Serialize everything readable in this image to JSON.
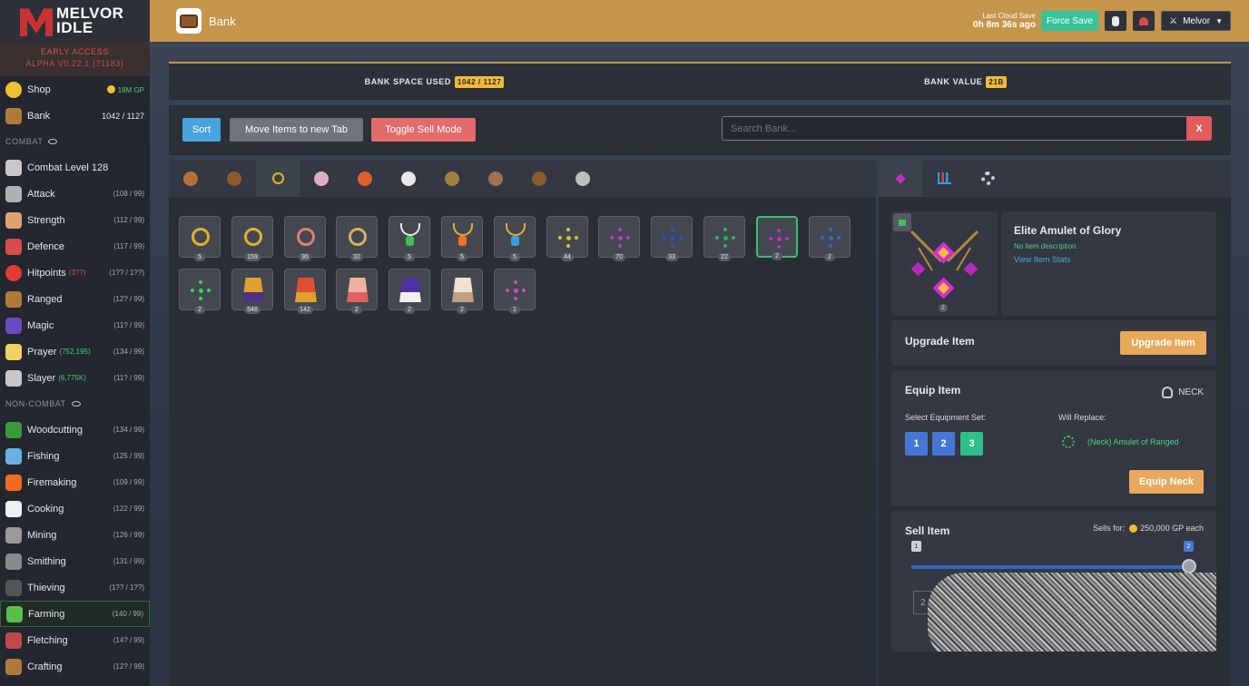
{
  "app": {
    "logo_top": "MELVOR",
    "logo_bottom": "IDLE",
    "early_access": "EARLY ACCESS",
    "version": "ALPHA V0.22.1 (?1183)"
  },
  "sidebar": {
    "top_items": [
      {
        "label": "Shop",
        "value": "18M GP",
        "icon": "coin-icon"
      },
      {
        "label": "Bank",
        "value": "1042 / 1127",
        "icon": "chest-icon"
      }
    ],
    "combat_header": "COMBAT",
    "combat": [
      {
        "label": "Combat Level 128",
        "value": "",
        "extra": "",
        "icon": "crossed-swords-icon"
      },
      {
        "label": "Attack",
        "value": "(108 / 99)",
        "extra": "",
        "icon": "sword-icon"
      },
      {
        "label": "Strength",
        "value": "(112 / 99)",
        "extra": "",
        "icon": "fist-icon"
      },
      {
        "label": "Defence",
        "value": "(117 / 99)",
        "extra": "",
        "icon": "shield-icon"
      },
      {
        "label": "Hitpoints",
        "value": "(1?? / 1??)",
        "extra": "(3??)",
        "icon": "heart-icon"
      },
      {
        "label": "Ranged",
        "value": "(12? / 99)",
        "extra": "",
        "icon": "bow-icon"
      },
      {
        "label": "Magic",
        "value": "(11? / 99)",
        "extra": "",
        "icon": "wizard-hat-icon"
      },
      {
        "label": "Prayer",
        "value": "(134 / 99)",
        "extra": "(752,195)",
        "icon": "sparkle-icon"
      },
      {
        "label": "Slayer",
        "value": "(11? / 99)",
        "extra": "(6,775K)",
        "icon": "skull-icon"
      }
    ],
    "noncombat_header": "NON-COMBAT",
    "noncombat": [
      {
        "label": "Woodcutting",
        "value": "(134 / 99)",
        "icon": "tree-icon"
      },
      {
        "label": "Fishing",
        "value": "(125 / 99)",
        "icon": "fish-icon"
      },
      {
        "label": "Firemaking",
        "value": "(109 / 99)",
        "icon": "fire-icon"
      },
      {
        "label": "Cooking",
        "value": "(122 / 99)",
        "icon": "chef-hat-icon"
      },
      {
        "label": "Mining",
        "value": "(126 / 99)",
        "icon": "pickaxe-icon"
      },
      {
        "label": "Smithing",
        "value": "(131 / 99)",
        "icon": "anvil-icon"
      },
      {
        "label": "Thieving",
        "value": "(1?? / 1??)",
        "icon": "thief-icon"
      },
      {
        "label": "Farming",
        "value": "(140 / 99)",
        "icon": "sprout-icon"
      },
      {
        "label": "Fletching",
        "value": "(14? / 99)",
        "icon": "arrow-icon"
      },
      {
        "label": "Crafting",
        "value": "(12? / 99)",
        "icon": "crafting-icon"
      }
    ]
  },
  "topbar": {
    "title": "Bank",
    "cloud_label": "Last Cloud Save",
    "cloud_time": "0h 8m 36s ago",
    "force_save": "Force Save",
    "user": "Melvor"
  },
  "bank": {
    "space_label": "BANK SPACE USED",
    "space_value": "1042 / 1127",
    "value_label": "BANK VALUE",
    "value_value": "21B",
    "sort": "Sort",
    "move": "Move Items to new Tab",
    "toggle": "Toggle Sell Mode",
    "search_placeholder": "Search Bank...",
    "search_clear": "X"
  },
  "tabs": [
    {
      "icon": "logs-icon",
      "color": "#b5703a"
    },
    {
      "icon": "log-icon",
      "color": "#8a5a2a"
    },
    {
      "icon": "ring-icon",
      "color": "#e0b030"
    },
    {
      "icon": "potion-icon",
      "color": "#e0b0c0"
    },
    {
      "icon": "rope-icon",
      "color": "#e06030"
    },
    {
      "icon": "orb-icon",
      "color": "#e8e8e8"
    },
    {
      "icon": "herb-icon",
      "color": "#a08040"
    },
    {
      "icon": "dagger-icon",
      "color": "#a07050"
    },
    {
      "icon": "feather-icon",
      "color": "#8a5a2a"
    },
    {
      "icon": "syringe-icon",
      "color": "#c0c0c0"
    }
  ],
  "items": [
    {
      "qty": "5",
      "type": "ring",
      "color": "#e0b030",
      "gem": "#e8e8e8"
    },
    {
      "qty": "159",
      "type": "ring",
      "color": "#e0b030",
      "gem": "#f0f0f0"
    },
    {
      "qty": "95",
      "type": "ring",
      "color": "#e08070",
      "gem": "#e08070"
    },
    {
      "qty": "32",
      "type": "ring",
      "color": "#d8b060",
      "gem": "#d8b060"
    },
    {
      "qty": "5",
      "type": "amulet",
      "color": "#e8e8e8",
      "gem": "#3fbf4e"
    },
    {
      "qty": "5",
      "type": "amulet",
      "color": "#e0b030",
      "gem": "#f07020"
    },
    {
      "qty": "5",
      "type": "amulet",
      "color": "#e0b030",
      "gem": "#3a9fe0"
    },
    {
      "qty": "44",
      "type": "dots",
      "color": "#d8c030",
      "gem": ""
    },
    {
      "qty": "70",
      "type": "dots",
      "color": "#b040c0",
      "gem": ""
    },
    {
      "qty": "33",
      "type": "dots",
      "color": "#3050c0",
      "gem": ""
    },
    {
      "qty": "22",
      "type": "dots",
      "color": "#30b050",
      "gem": ""
    },
    {
      "qty": "2",
      "type": "dots",
      "color": "#c030c0",
      "gem": "",
      "selected": true
    },
    {
      "qty": "2",
      "type": "dots",
      "color": "#4060d0",
      "gem": ""
    },
    {
      "qty": "2",
      "type": "dots",
      "color": "#40d050",
      "gem": ""
    },
    {
      "qty": "548",
      "type": "cape",
      "color": "#e0a030",
      "gem": "#503080"
    },
    {
      "qty": "142",
      "type": "cape",
      "color": "#e05030",
      "gem": "#e0a030"
    },
    {
      "qty": "2",
      "type": "cape",
      "color": "#f0b0a0",
      "gem": "#e06060"
    },
    {
      "qty": "2",
      "type": "cape",
      "color": "#5030a0",
      "gem": "#f0f0f0"
    },
    {
      "qty": "2",
      "type": "cape",
      "color": "#f0e0d0",
      "gem": "#c0a080"
    },
    {
      "qty": "1",
      "type": "dots",
      "color": "#c050c0",
      "gem": ""
    }
  ],
  "side_tabs": [
    {
      "icon": "amulet-icon",
      "color": "#c030c0"
    },
    {
      "icon": "bar-chart-icon",
      "color": "#30a0e0"
    },
    {
      "icon": "gear-icon",
      "color": "#d0d0d0"
    }
  ],
  "detail": {
    "qty": "2",
    "name": "Elite Amulet of Glory",
    "description": "No item description.",
    "view_stats": "View Item Stats",
    "upgrade_title": "Upgrade Item",
    "upgrade_btn": "Upgrade Item",
    "equip_title": "Equip Item",
    "slot": "NECK",
    "set_label": "Select Equipment Set:",
    "sets": [
      "1",
      "2",
      "3"
    ],
    "replace_label": "Will Replace:",
    "replace_item": "(Neck) Amulet of Ranged",
    "equip_btn": "Equip Neck",
    "sell_title": "Sell Item",
    "sells_for": "Sells for:",
    "sell_price": "250,000 GP each",
    "slider_min": "1",
    "slider_max": "2",
    "sell_qty": "2"
  }
}
